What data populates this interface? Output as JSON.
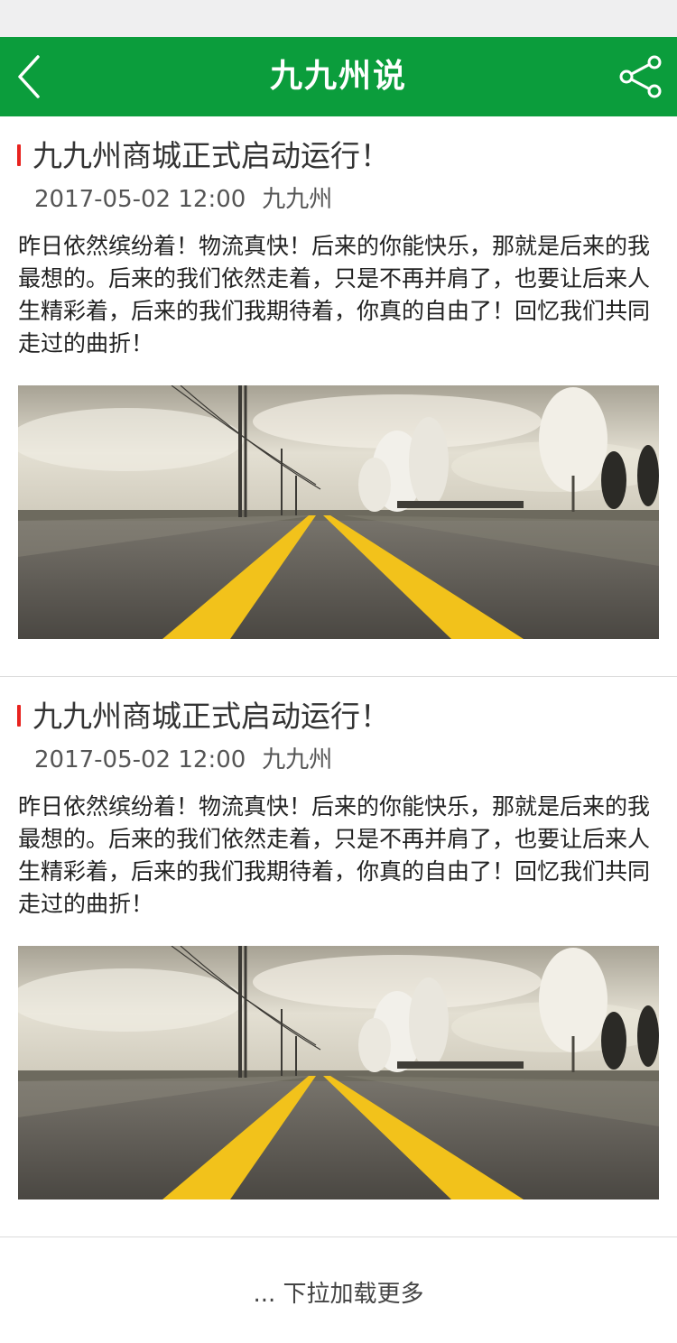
{
  "header": {
    "title": "九九州说",
    "back_icon": "chevron-left-icon",
    "share_icon": "share-icon",
    "background_color": "#0b9d3c"
  },
  "articles": [
    {
      "title": "九九州商城正式启动运行！",
      "date": "2017-05-02 12:00",
      "author": "九九州",
      "body": "昨日依然缤纷着！物流真快！后来的你能快乐，那就是后来的我最想的。后来的我们依然走着，只是不再并肩了，也要让后来人生精彩着，后来的我们我期待着，你真的自由了！回忆我们共同走过的曲折！",
      "image": "road-photo"
    },
    {
      "title": "九九州商城正式启动运行！",
      "date": "2017-05-02 12:00",
      "author": "九九州",
      "body": "昨日依然缤纷着！物流真快！后来的你能快乐，那就是后来的我最想的。后来的我们依然走着，只是不再并肩了，也要让后来人生精彩着，后来的我们我期待着，你真的自由了！回忆我们共同走过的曲折！",
      "image": "road-photo"
    }
  ],
  "footer": {
    "load_more": "... 下拉加载更多"
  },
  "colors": {
    "accent_marker": "#e8231f",
    "road_line": "#f2c21b"
  }
}
